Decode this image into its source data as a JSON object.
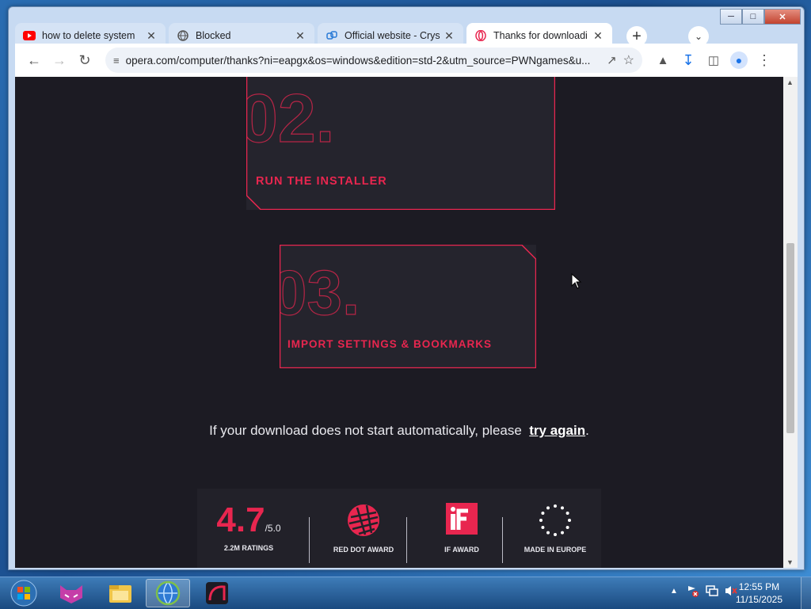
{
  "tabs": [
    {
      "title": "how to delete system",
      "icon": "youtube-icon",
      "active": false
    },
    {
      "title": "Blocked",
      "icon": "globe-icon",
      "active": false
    },
    {
      "title": "Official website - Crys",
      "icon": "link-icon",
      "active": false
    },
    {
      "title": "Thanks for downloadi",
      "icon": "opera-icon",
      "active": true
    }
  ],
  "omnibox": {
    "url": "opera.com/computer/thanks?ni=eapgx&os=windows&edition=std-2&utm_source=PWNgames&u..."
  },
  "steps": [
    {
      "number": "02.",
      "label": "RUN THE INSTALLER"
    },
    {
      "number": "03.",
      "label": "IMPORT SETTINGS & BOOKMARKS"
    }
  ],
  "notice": {
    "text": "If your download does not start automatically, please",
    "link": "try again",
    "suffix": "."
  },
  "stats": {
    "rating": "4.7",
    "rating_max": "/5.0",
    "ratings_label": "2.2M RATINGS",
    "reddot_label": "RED DOT AWARD",
    "if_label": "IF AWARD",
    "europe_label": "MADE IN EUROPE"
  },
  "clock": {
    "time": "12:55 PM",
    "date": "11/15/2025"
  },
  "colors": {
    "accent": "#e8264f",
    "page_bg": "#1c1b23"
  }
}
